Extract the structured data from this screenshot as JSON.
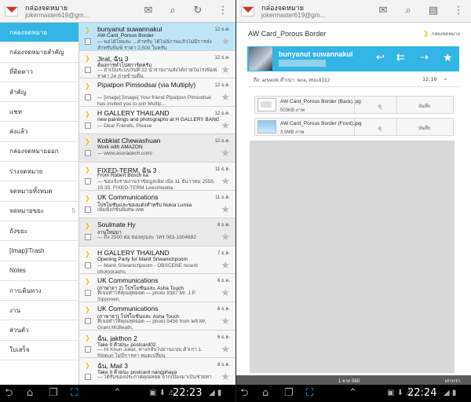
{
  "left": {
    "appbar": {
      "title": "กล่องจดหมาย",
      "account": "jokermaster619@gm..."
    },
    "nav": [
      {
        "label": "กล่องจดหมาย",
        "count": ""
      },
      {
        "label": "กล่องจดหมายสำคัญ",
        "count": ""
      },
      {
        "label": "ที่ติดดาว",
        "count": ""
      },
      {
        "label": "สำคัญ",
        "count": ""
      },
      {
        "label": "แชท",
        "count": ""
      },
      {
        "label": "ส่งแล้ว",
        "count": ""
      },
      {
        "label": "กล่องจดหมายออก",
        "count": ""
      },
      {
        "label": "ร่างจดหมาย",
        "count": ""
      },
      {
        "label": "จดหมายทั้งหมด",
        "count": ""
      },
      {
        "label": "จดหมายขยะ",
        "count": "5"
      },
      {
        "label": "ถังขยะ",
        "count": ""
      },
      {
        "label": "[Imap]/Trash",
        "count": ""
      },
      {
        "label": "Notes",
        "count": ""
      },
      {
        "label": "การเดินทาง",
        "count": ""
      },
      {
        "label": "งาน",
        "count": ""
      },
      {
        "label": "ส่วนตัว",
        "count": ""
      },
      {
        "label": "ใบเสร็จ",
        "count": ""
      }
    ],
    "emails": [
      {
        "sender": "bunyanut suwannakul",
        "subject": "AW Card_Porous Border",
        "snippet": "— พอได้ไหมคะ ...สำหรับ ได้ไฟล์ภาพแล้วไม่มีการส่งสำหรับพิมพ์ ราคา 2,500 ใบครับ",
        "date": "12 ธ.ค."
      },
      {
        "sender": "Jirat, ฉัน 3",
        "subject": "ต้องการทำโปสการ์ดครับ",
        "snippet": "— ถ้าเป็นระบบวันที่ 22 นำรายงานส่งได้ภายในโรงพิมพ์ราคา 24 ถ่ายข้ามคืน",
        "date": "12 ธ.ค."
      },
      {
        "sender": "Pipatpon Pimsodsai (via Multiply)",
        "subject": "",
        "snippet": "— [image] [image] Your friend Pipatpon Pimsodsai has invited you to join Multip...",
        "date": "12 ธ.ค."
      },
      {
        "sender": "H GALLERY THAILAND",
        "subject": "new paintings and photographs at H GALLERY BANGKOK & CHIANG MAI",
        "snippet": "— Dear Friends, Please",
        "date": "12 ธ.ค."
      },
      {
        "sender": "Kobkiat Chewashuan",
        "subject": "Work with AMAZON",
        "snippet": "— www.asuradech.com/",
        "date": "12 ธ.ค."
      },
      {
        "sender": "FIXED-TERM, ฉัน 3",
        "subject": "From Robert Bosch ka",
        "snippet": "— ขอแจ้งรายงานว่าข้อมูลเพิ่ม เมื่อ 11 ธันวาคม 2555, 15:35, FIXED-TERM Leesiriwatta.",
        "date": "11 ธ.ค."
      },
      {
        "sender": "UK Communications",
        "subject": "โปรโมชันและของแต่งสำหรับ Nokia Lumia",
        "snippet": "เพิ่มฟังก์ชันพิเศษ-เทค",
        "date": "11 ธ.ค."
      },
      {
        "sender": "Soulmate Hy",
        "subject": "งานใหม่มา",
        "snippet": "— ถึง 2500 ต่อ ทองคุณละ โทร 083-1904682",
        "date": "8 ธ.ค."
      },
      {
        "sender": "H GALLERY THAILAND",
        "subject": "Opening Party for Manit Sriwanichpoom",
        "snippet": "— Manit Sriwanichpoom - OBSCENE recent photographs",
        "date": "7 ธ.ค."
      },
      {
        "sender": "UK Communications",
        "subject": "(ภาษาจา 2) โปรโมชันและ Asha Touch",
        "snippet": "ที่เจอทำให้คุณสุดยอด — photo 9387 Mr. J.P. Sipponen,",
        "date": "6 ธ.ค."
      },
      {
        "sender": "UK Communications",
        "subject": "(ภาษาจา) โปรโมชันและ Asha Touch",
        "snippet": "ที่เจอทำให้คุณสุดยอด — photo 9456 from left Mr. Grant McBeath,",
        "date": "6 ธ.ค."
      },
      {
        "sender": "ฉัน, jakthon 2",
        "subject": "Take It ด้วยนะ postcard02",
        "snippet": "— Hi Khun Joker, ทางกลับไปอ่านแบบ ตัวเก่า 1. Ribbon ไม่มีการทา หมดเปลี่ยน",
        "date": "6 ธ.ค."
      },
      {
        "sender": "ฉัน, Mail 3",
        "subject": "Take It ด้วยนะ postcard nangphaya",
        "snippet": "— ได้รับของประกาศคุณหยด จากเมืองมาเป็นช่วยทา",
        "date": "6 ธ.ค."
      }
    ],
    "clock": "22:23"
  },
  "right": {
    "appbar": {
      "title": "กล่องจดหมาย",
      "account": "jokermaster619@gm..."
    },
    "subject": "AW Card_Porous Border",
    "label": "กล่องจดหมาย",
    "header": {
      "sender": "bunyanut suwannakul"
    },
    "recipients": "ถึง: artwork สำเนา: tera, ลบแล312",
    "time": "12:19",
    "attachments": [
      {
        "name": "AW Card_Porous Border (Back).jpg",
        "size": "503KB ภาพ",
        "view": "ดู",
        "save": "บันทึก"
      },
      {
        "name": "AW Card_Porous Border (Front).jpg",
        "size": "3.5MB ภาพ",
        "view": "ดู",
        "save": "บันทึก"
      }
    ],
    "footer": {
      "position": "1 จาก 550",
      "newer": "เก่ากว่า"
    },
    "clock": "22:24"
  },
  "icons": {
    "compose": "compose-icon",
    "search": "search-icon",
    "refresh": "refresh-icon",
    "labels": "labels-icon",
    "menu": "overflow-menu-icon",
    "reply": "reply-icon",
    "reply_all": "reply-all-icon",
    "forward": "forward-icon",
    "star": "star-icon"
  },
  "colors": {
    "accent": "#33b5e5",
    "important": "#e8c500"
  }
}
